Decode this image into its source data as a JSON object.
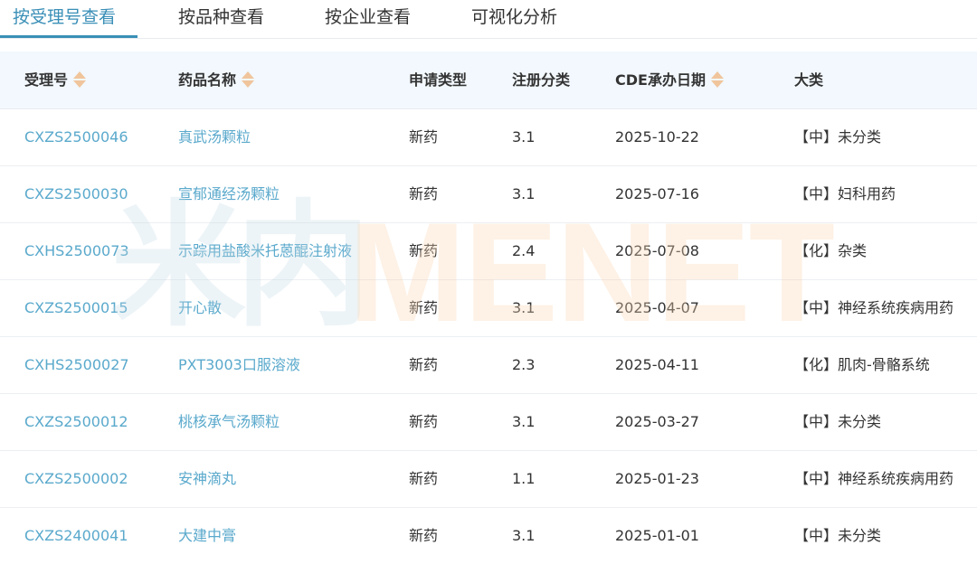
{
  "tabs": [
    {
      "label": "按受理号查看",
      "active": true
    },
    {
      "label": "按品种查看",
      "active": false
    },
    {
      "label": "按企业查看",
      "active": false
    },
    {
      "label": "可视化分析",
      "active": false
    }
  ],
  "table": {
    "headers": {
      "accept_no": "受理号",
      "drug_name": "药品名称",
      "apply_type": "申请类型",
      "reg_class": "注册分类",
      "cde_date": "CDE承办日期",
      "category": "大类"
    },
    "rows": [
      {
        "accept_no": "CXZS2500046",
        "drug_name": "真武汤颗粒",
        "apply_type": "新药",
        "reg_class": "3.1",
        "cde_date": "2025-10-22",
        "category": "【中】未分类"
      },
      {
        "accept_no": "CXZS2500030",
        "drug_name": "宣郁通经汤颗粒",
        "apply_type": "新药",
        "reg_class": "3.1",
        "cde_date": "2025-07-16",
        "category": "【中】妇科用药"
      },
      {
        "accept_no": "CXHS2500073",
        "drug_name": "示踪用盐酸米托蒽醌注射液",
        "apply_type": "新药",
        "reg_class": "2.4",
        "cde_date": "2025-07-08",
        "category": "【化】杂类"
      },
      {
        "accept_no": "CXZS2500015",
        "drug_name": "开心散",
        "apply_type": "新药",
        "reg_class": "3.1",
        "cde_date": "2025-04-07",
        "category": "【中】神经系统疾病用药"
      },
      {
        "accept_no": "CXHS2500027",
        "drug_name": "PXT3003口服溶液",
        "apply_type": "新药",
        "reg_class": "2.3",
        "cde_date": "2025-04-11",
        "category": "【化】肌肉-骨骼系统"
      },
      {
        "accept_no": "CXZS2500012",
        "drug_name": "桃核承气汤颗粒",
        "apply_type": "新药",
        "reg_class": "3.1",
        "cde_date": "2025-03-27",
        "category": "【中】未分类"
      },
      {
        "accept_no": "CXZS2500002",
        "drug_name": "安神滴丸",
        "apply_type": "新药",
        "reg_class": "1.1",
        "cde_date": "2025-01-23",
        "category": "【中】神经系统疾病用药"
      },
      {
        "accept_no": "CXZS2400041",
        "drug_name": "大建中膏",
        "apply_type": "新药",
        "reg_class": "3.1",
        "cde_date": "2025-01-01",
        "category": "【中】未分类"
      }
    ]
  },
  "watermark": {
    "cn": "米内",
    "en": "MENET"
  },
  "colors": {
    "accent": "#3a8fb7",
    "link": "#5aa9cc",
    "header_bg": "#f2f8fd",
    "sort_icon": "#f0c59c"
  }
}
